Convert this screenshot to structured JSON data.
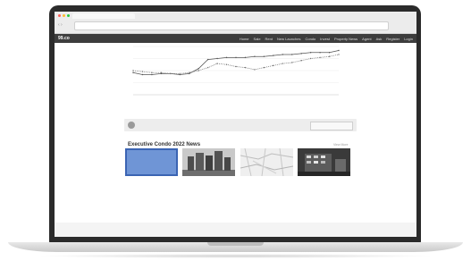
{
  "browser": {
    "dot_colors": [
      "#ff5f57",
      "#febc2e",
      "#28c840"
    ],
    "nav_glyphs": "‹ ›"
  },
  "site": {
    "logo": "99.co",
    "menu_items": [
      "Home",
      "Sale",
      "Rent",
      "New Launches",
      "Condo",
      "Invest",
      "Property News",
      "Agent",
      "Ask",
      "Register",
      "Login"
    ]
  },
  "chart_data": {
    "type": "line",
    "series": [
      {
        "name": "",
        "style": "solid",
        "color": "#555555",
        "values": [
          22,
          20,
          20,
          21,
          21,
          20,
          21,
          26,
          35,
          36,
          37,
          37,
          37,
          38,
          38,
          39,
          40,
          40,
          41,
          42,
          42,
          42,
          44
        ]
      },
      {
        "name": "",
        "style": "dotted",
        "color": "#777777",
        "values": [
          24,
          23,
          22,
          22,
          21,
          21,
          22,
          24,
          27,
          31,
          30,
          28,
          27,
          25,
          27,
          29,
          31,
          32,
          34,
          36,
          37,
          38,
          40
        ]
      }
    ],
    "ylim": [
      0,
      48
    ],
    "grid": true,
    "legend": "bottom"
  },
  "legend": {
    "entries": [
      "",
      ""
    ]
  },
  "alert": {
    "text": "",
    "button": ""
  },
  "news": {
    "title": "Executive Condo 2022 News",
    "view_more": "View More",
    "cards": [
      {
        "source": "",
        "line1": "",
        "line2": "",
        "thumb": "blue-placeholder"
      },
      {
        "source": "",
        "line1": "",
        "line2": "",
        "thumb": "tower-photo"
      },
      {
        "source": "",
        "line1": "",
        "line2": "",
        "thumb": "map-image"
      },
      {
        "source": "",
        "line1": "",
        "line2": "",
        "thumb": "night-building-photo"
      }
    ]
  }
}
